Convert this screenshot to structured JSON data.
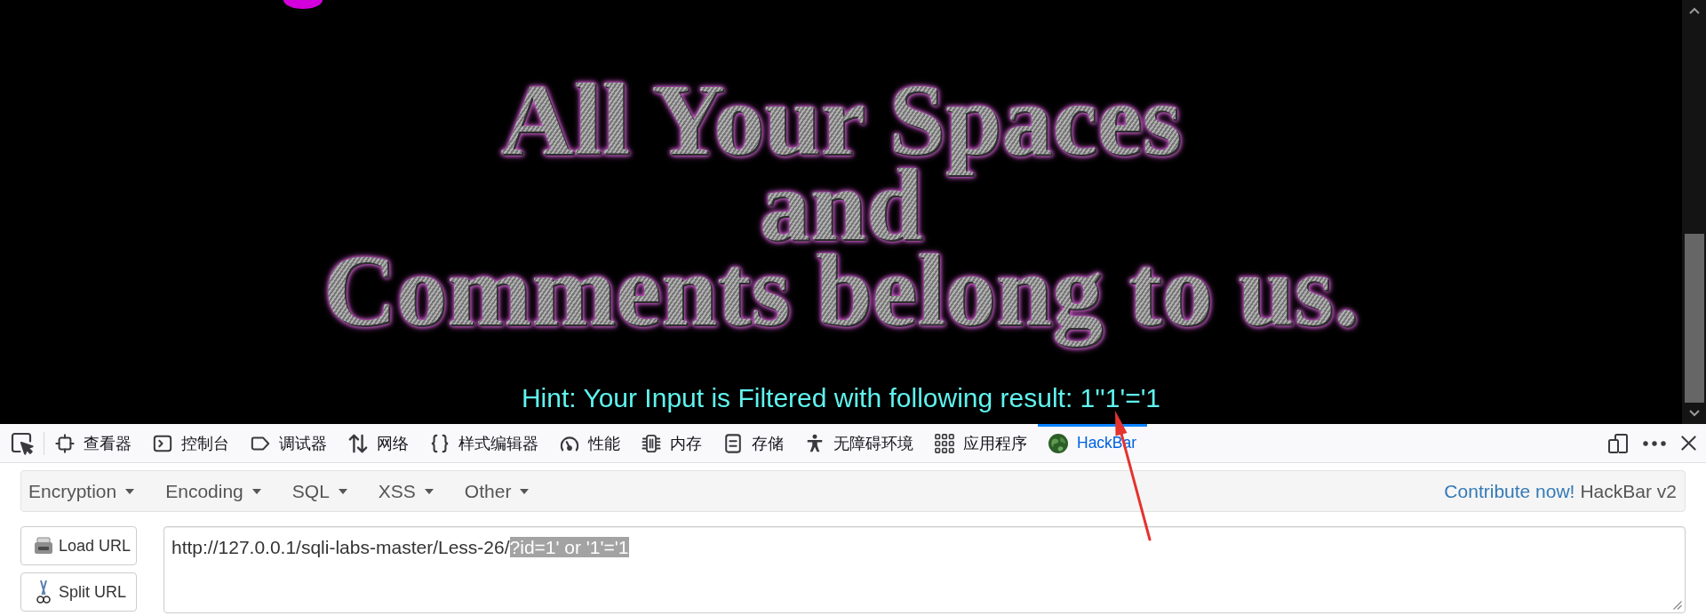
{
  "page": {
    "headline_lines": [
      "All Your Spaces",
      "and",
      "Comments belong to us."
    ],
    "hint": "Hint: Your Input is Filtered with following result: 1''1'='1"
  },
  "devtools": {
    "tabs": [
      {
        "label": "查看器",
        "selected": false
      },
      {
        "label": "控制台",
        "selected": false
      },
      {
        "label": "调试器",
        "selected": false
      },
      {
        "label": "网络",
        "selected": false
      },
      {
        "label": "样式编辑器",
        "selected": false
      },
      {
        "label": "性能",
        "selected": false
      },
      {
        "label": "内存",
        "selected": false
      },
      {
        "label": "存储",
        "selected": false
      },
      {
        "label": "无障碍环境",
        "selected": false
      },
      {
        "label": "应用程序",
        "selected": false
      },
      {
        "label": "HackBar",
        "selected": true
      }
    ]
  },
  "hackbar": {
    "menus": [
      "Encryption",
      "Encoding",
      "SQL",
      "XSS",
      "Other"
    ],
    "contribute_link": "Contribute now!",
    "version": "HackBar v2",
    "buttons": [
      "Load URL",
      "Split URL"
    ],
    "url_field": {
      "text": "http://127.0.0.1/sqli-labs-master/Less-26/",
      "selected_text": "?id=1' or '1'='1"
    }
  }
}
